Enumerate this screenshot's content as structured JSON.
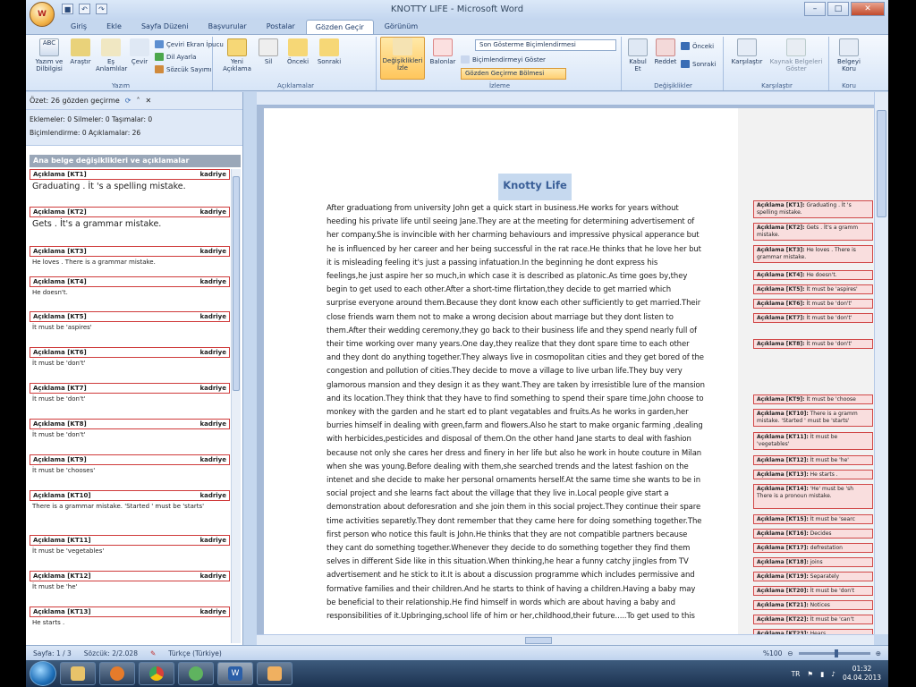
{
  "window": {
    "title": "KNOTTY LIFE - Microsoft Word",
    "office_button": "W"
  },
  "tabs": [
    "Giriş",
    "Ekle",
    "Sayfa Düzeni",
    "Başvurular",
    "Postalar",
    "Gözden Geçir",
    "Görünüm"
  ],
  "active_tab_index": 5,
  "ribbon": {
    "yazim": {
      "label": "Yazım",
      "buttons": [
        "Yazım ve Dilbilgisi",
        "Araştır",
        "Eş Anlamlılar",
        "Çevir"
      ],
      "small": [
        "Çeviri Ekran İpucu",
        "Dil Ayarla",
        "Sözcük Sayımı"
      ]
    },
    "aciklamalar": {
      "label": "Açıklamalar",
      "buttons": [
        "Yeni Açıklama",
        "Sil",
        "Önceki",
        "Sonraki"
      ]
    },
    "izleme": {
      "label": "İzleme",
      "buttons": [
        "Değişiklikleri İzle",
        "Balonlar"
      ],
      "combo": "Son Gösterme Biçimlendirmesi",
      "small": [
        "Biçimlendirmeyi Göster",
        "Gözden Geçirme Bölmesi"
      ]
    },
    "degisiklikler": {
      "label": "Değişiklikler",
      "buttons": [
        "Kabul Et",
        "Reddet"
      ],
      "small": [
        "Önceki",
        "Sonraki"
      ]
    },
    "karsilastir": {
      "label": "Karşılaştır",
      "buttons": [
        "Karşılaştır",
        "Kaynak Belgeleri Göster"
      ]
    },
    "koru": {
      "label": "Koru",
      "buttons": [
        "Belgeyi Koru"
      ]
    }
  },
  "review_pane": {
    "summary": "Özet: 26 gözden geçirme",
    "stats1": "Eklemeler: 0  Silmeler: 0  Taşımalar: 0",
    "stats2": "Biçimlendirme: 0  Açıklamalar: 26",
    "section": "Ana belge değişiklikleri ve açıklamalar",
    "author": "kadriye",
    "comments": [
      {
        "id": "Açıklama [KT1]",
        "text": "Graduating . İt 's a spelling mistake.",
        "big": true
      },
      {
        "id": "Açıklama [KT2]",
        "text": "Gets . İt's a grammar mistake.",
        "big": true
      },
      {
        "id": "Açıklama [KT3]",
        "text": "He loves . There is a  grammar mistake."
      },
      {
        "id": "Açıklama [KT4]",
        "text": "He doesn't."
      },
      {
        "id": "Açıklama [KT5]",
        "text": "İt must be 'aspires'"
      },
      {
        "id": "Açıklama [KT6]",
        "text": "İt must be 'don't'"
      },
      {
        "id": "Açıklama [KT7]",
        "text": "İt must be 'don't'"
      },
      {
        "id": "Açıklama [KT8]",
        "text": "İt must be 'don't'"
      },
      {
        "id": "Açıklama [KT9]",
        "text": "İt must be 'chooses'"
      },
      {
        "id": "Açıklama [KT10]",
        "text": "There is a grammar mistake. 'Started ' must be 'starts'"
      },
      {
        "id": "Açıklama [KT11]",
        "text": "İt must be  'vegetables'"
      },
      {
        "id": "Açıklama [KT12]",
        "text": "İt must be 'he'"
      },
      {
        "id": "Açıklama [KT13]",
        "text": "He starts ."
      }
    ]
  },
  "document": {
    "title": "Knotty Life",
    "lines": [
      "After graduationg from university  John get a quick start in business.He works for years without",
      "heeding his private life until seeing Jane.They are at the meeting for determining advertisement of",
      "her company.She is  invincible with her charming behaviours and impressive physical apperance but",
      "he is influenced by her career and her being successful in the rat race.He thinks that he love her but",
      "it is misleading feeling  it's  just a  passing infatuation.In the beginning he dont express his",
      "feelings,he just aspire her so much,in which case it is described as platonic.As time goes by,they",
      "begin to get used to each other.After a short-time flirtation,they decide to get married which",
      "surprise everyone around  them.Because they dont know each other sufficiently to get married.Their",
      "close friends warn them not to make a wrong decision about marriage but they dont listen to",
      "them.After their wedding ceremony,they go back to their business life and they spend nearly full of",
      "their time working over many years.One day,they realize that  they dont spare time to each other",
      "and they dont do anything together.They always live in cosmopolitan cities and they get bored of the",
      "congestion and pollution of cities.They decide to move a village to live urban life.They buy very",
      "glamorous mansion and they design it as they want.They are taken by irresistible lure of the mansion",
      "and its location.They think that they have to find something to spend their spare time.John choose to",
      "monkey with the garden and he start ed to plant vegatables and fruits.As he works in garden,her",
      "burries himself in dealing with green,farm and flowers.Also he start to make organic farming ,dealing",
      "with herbicides,pesticides and disposal of them.On the other hand Jane starts to deal with fashion",
      "because not only she cares her dress and finery in her life but also he work in houte couture in Milan",
      "when she was young.Before dealing with them,she searched trends and the latest fashion on the",
      "intenet and she decide to make her personal ornaments herself.At the same time she wants to be in",
      "social project and she learns fact about the village that they live in.Local people give start a",
      "demonstration about deforesration and she join them in this social project.They continue their spare",
      "time activities separetly.They dont remember that they came here for doing something together.The",
      "first person who notice this fault is John.He thinks that they are not compatible partners because",
      "they cant do something together.Whenever they decide to do something together they find them",
      "selves in different Side like in this situation.When thinking,he hear a funny catchy jingles from TV",
      "advertisement and he stick to it.It is about a discussion programme which includes permissive and",
      "formative families and their children.And he starts to think of having a children.Having a baby may",
      "be beneficial to their relationship.He find himself in words which are about having a baby and",
      "responsibilities of it.Upbringing,school life of him or her,childhood,their future.....To get used to this"
    ],
    "balloons": [
      {
        "label": "Açıklama [KT1]:",
        "text": "Graduating . İt 's spelling mistake."
      },
      {
        "label": "Açıklama [KT2]:",
        "text": "Gets . İt's a gramm mistake."
      },
      {
        "label": "Açıklama [KT3]:",
        "text": "He loves . There is grammar mistake."
      },
      {
        "label": "Açıklama [KT4]:",
        "text": "He doesn't."
      },
      {
        "label": "Açıklama [KT5]:",
        "text": "İt must be 'aspires'"
      },
      {
        "label": "Açıklama [KT6]:",
        "text": "İt must be 'don't'"
      },
      {
        "label": "Açıklama [KT7]:",
        "text": "İt must be 'don't'"
      },
      {
        "label": "Açıklama [KT8]:",
        "text": "İt must be 'don't'"
      },
      {
        "label": "Açıklama [KT9]:",
        "text": "İt must be 'choose"
      },
      {
        "label": "Açıklama [KT10]:",
        "text": "There is a gramm mistake. 'Started ' must be 'starts'"
      },
      {
        "label": "Açıklama [KT11]:",
        "text": "İt must be 'vegetables'"
      },
      {
        "label": "Açıklama [KT12]:",
        "text": "İt must be 'he'"
      },
      {
        "label": "Açıklama [KT13]:",
        "text": "He starts ."
      },
      {
        "label": "Açıklama [KT14]:",
        "text": "'He'  must be 'sh There is a pronoun mistake."
      },
      {
        "label": "Açıklama [KT15]:",
        "text": "İt must be 'searc"
      },
      {
        "label": "Açıklama [KT16]:",
        "text": "Decides"
      },
      {
        "label": "Açıklama [KT17]:",
        "text": "defrestation"
      },
      {
        "label": "Açıklama [KT18]:",
        "text": "joins"
      },
      {
        "label": "Açıklama [KT19]:",
        "text": "Separately"
      },
      {
        "label": "Açıklama [KT20]:",
        "text": "İt must be 'don't"
      },
      {
        "label": "Açıklama [KT21]:",
        "text": "Notices"
      },
      {
        "label": "Açıklama [KT22]:",
        "text": "İt must be 'can't"
      },
      {
        "label": "Açıklama [KT23]:",
        "text": "Hears"
      }
    ]
  },
  "status": {
    "page": "Sayfa: 1 / 3",
    "words": "Sözcük: 2/2.028",
    "lang": "Türkçe (Türkiye)",
    "zoom": "%100"
  },
  "taskbar": {
    "lang": "TR",
    "time": "01:32",
    "date": "04.04.2013"
  }
}
